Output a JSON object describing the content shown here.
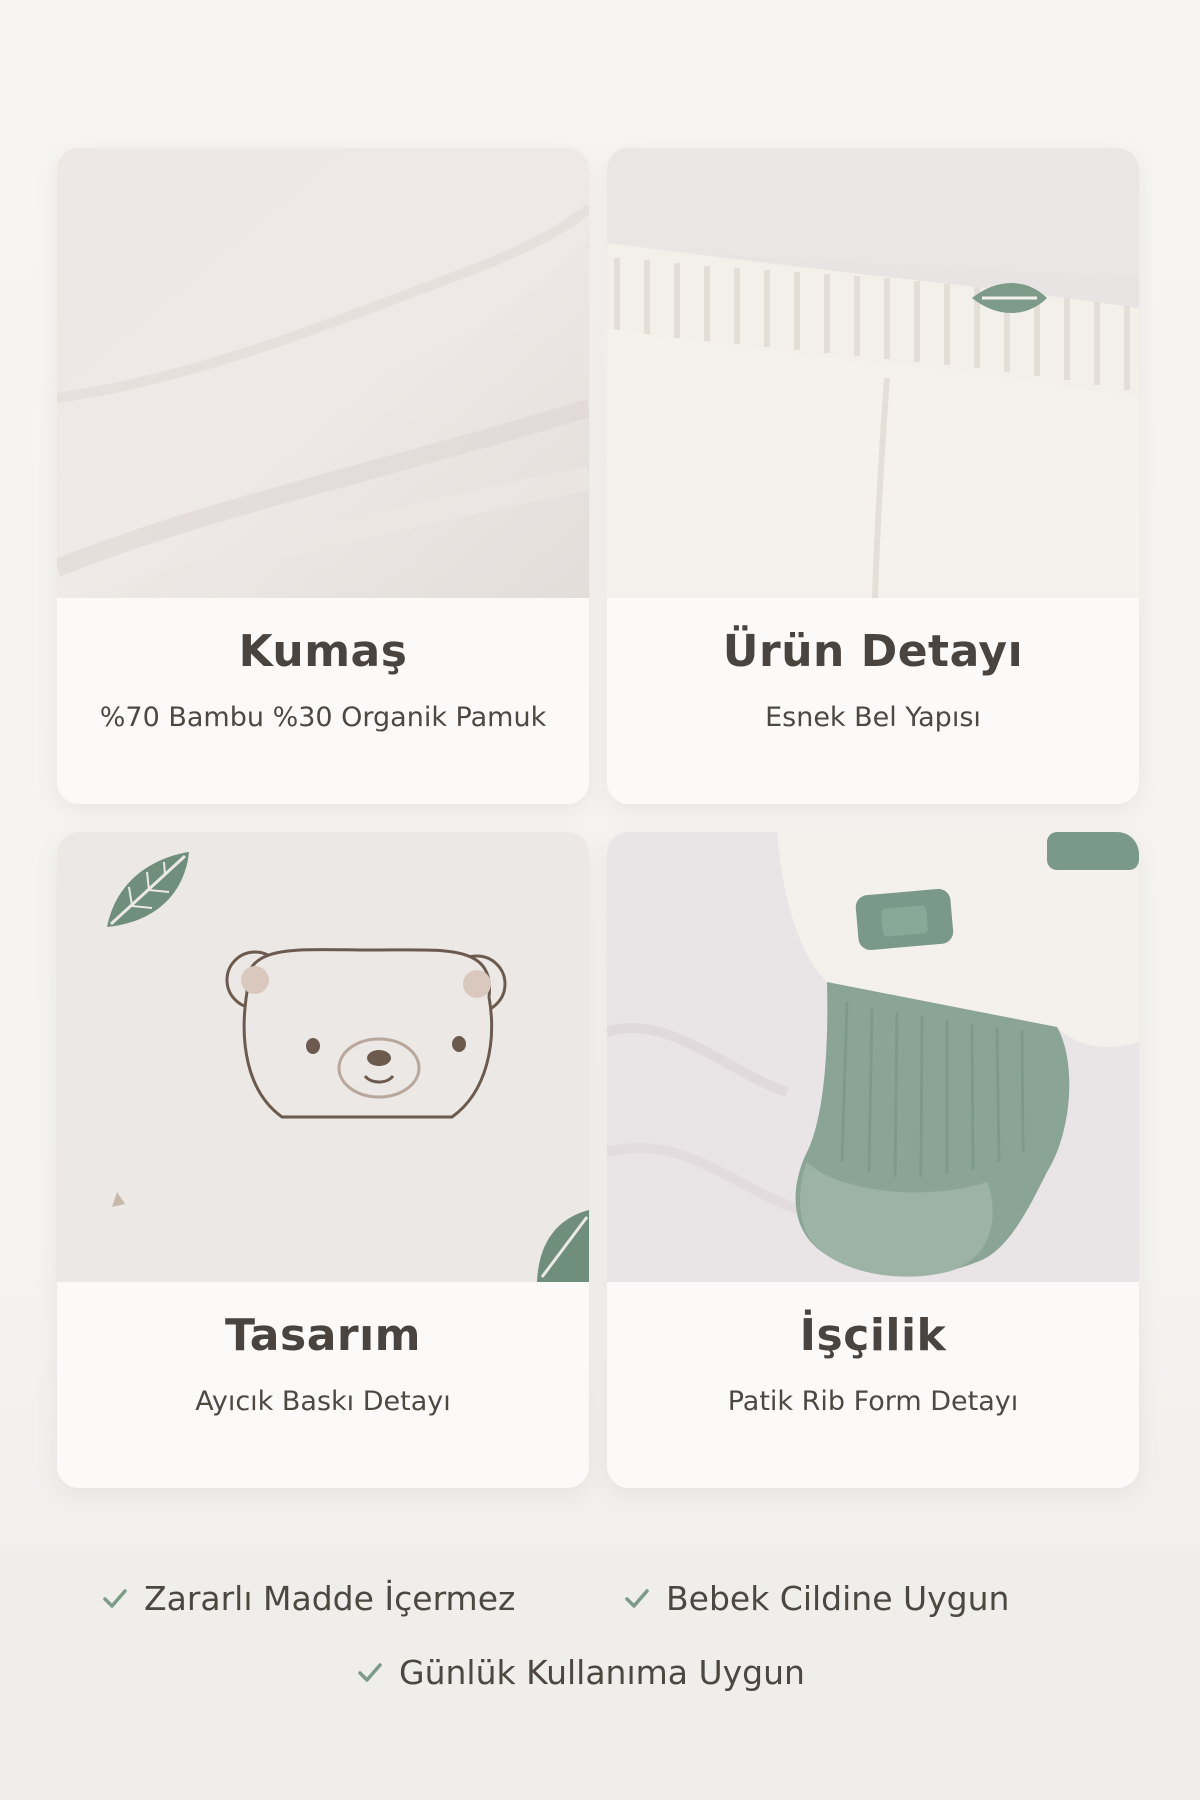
{
  "cards": [
    {
      "title": "Kumaş",
      "subtitle": "%70 Bambu %30 Organik Pamuk",
      "image": "fabric-closeup"
    },
    {
      "title": "Ürün Detayı",
      "subtitle": "Esnek Bel Yapısı",
      "image": "elastic-waistband"
    },
    {
      "title": "Tasarım",
      "subtitle": "Ayıcık Baskı Detayı",
      "image": "bear-print"
    },
    {
      "title": "İşçilik",
      "subtitle": "Patik Rib Form Detayı",
      "image": "rib-footie"
    }
  ],
  "features": [
    {
      "label": "Zararlı Madde İçermez",
      "icon": "check-icon"
    },
    {
      "label": "Bebek Cildine Uygun",
      "icon": "check-icon"
    },
    {
      "label": "Günlük Kullanıma Uygun",
      "icon": "check-icon"
    }
  ],
  "colors": {
    "background": "#f6f4f2",
    "card": "#fbfaf9",
    "accent_green": "#7e9b8a",
    "text": "#4a4440"
  }
}
